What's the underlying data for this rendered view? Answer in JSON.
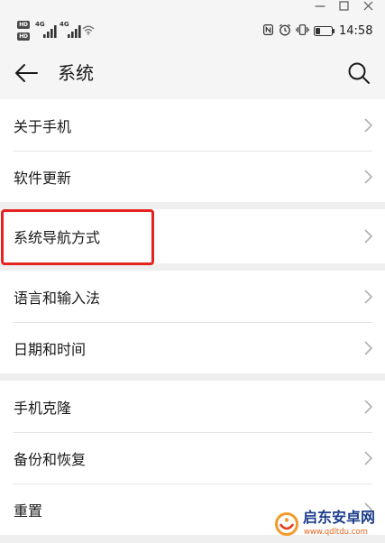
{
  "window_controls": {
    "minimize_icon": "minimize-icon",
    "maximize_icon": "maximize-icon",
    "close_icon": "close-icon"
  },
  "status_bar": {
    "hd_badges": [
      "HD",
      "HD"
    ],
    "sim1_network": "4G",
    "sim2_network": "4G",
    "wifi_icon": "wifi-icon",
    "nfc_icon": "nfc-icon",
    "alarm_icon": "alarm-icon",
    "vibrate_icon": "vibrate-icon",
    "battery_icon": "battery-icon",
    "battery_level_percent": 30,
    "time": "14:58"
  },
  "header": {
    "back_icon": "back-arrow-icon",
    "title": "系统",
    "search_icon": "search-icon"
  },
  "settings_groups": [
    {
      "items": [
        {
          "label": "关于手机"
        },
        {
          "label": "软件更新"
        }
      ]
    },
    {
      "items": [
        {
          "label": "系统导航方式",
          "highlighted": true
        }
      ]
    },
    {
      "items": [
        {
          "label": "语言和输入法"
        },
        {
          "label": "日期和时间"
        }
      ]
    },
    {
      "items": [
        {
          "label": "手机克隆"
        },
        {
          "label": "备份和恢复"
        },
        {
          "label": "重置"
        }
      ]
    }
  ],
  "row_chevron_icon": "chevron-right-icon",
  "watermark": {
    "logo_icon": "watermark-logo-icon",
    "name": "启东安卓网",
    "url": "www.qdltdu.com"
  },
  "colors": {
    "highlight_box": "#e5231f",
    "watermark_name": "#1c3f8c",
    "watermark_url": "#e8651c",
    "page_background": "#efefef",
    "list_background": "#ffffff"
  }
}
